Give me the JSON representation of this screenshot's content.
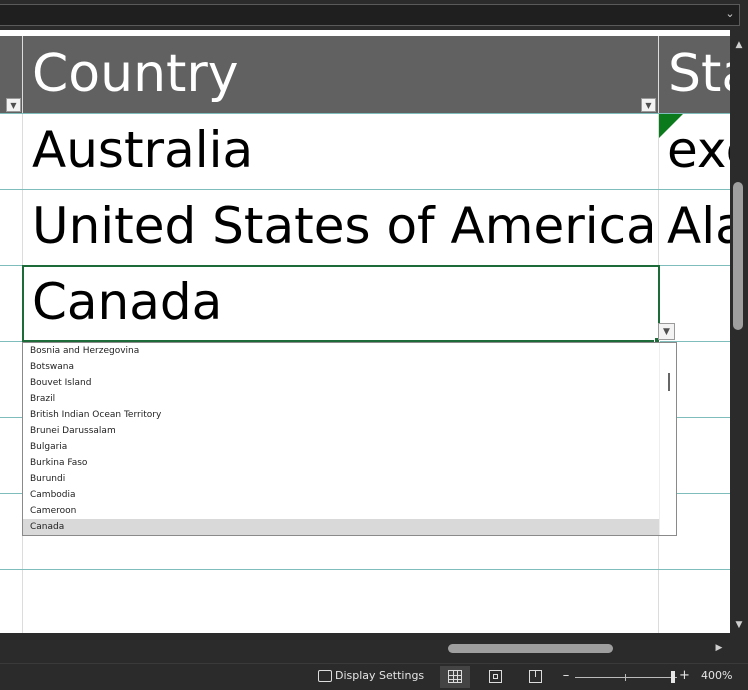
{
  "colors": {
    "header_bg": "#616161",
    "active_border": "#1e6b3a",
    "row_divider": "#7fbcbc",
    "selected_item_bg": "#d9d9d9",
    "error_flag": "#0a7a1c"
  },
  "formula_bar": {
    "expand_icon": "chevron-down-icon"
  },
  "table": {
    "headers": [
      "",
      "Country",
      "Sta"
    ],
    "filter_icon": "filter-dropdown-icon",
    "rows": [
      {
        "country": "Australia",
        "state": "exc"
      },
      {
        "country": "United States of America",
        "state": "Ala"
      },
      {
        "country": "Canada",
        "state": ""
      }
    ]
  },
  "dropdown": {
    "items": [
      "Bosnia and Herzegovina",
      "Botswana",
      "Bouvet Island",
      "Brazil",
      "British Indian Ocean Territory",
      "Brunei Darussalam",
      "Bulgaria",
      "Burkina Faso",
      "Burundi",
      "Cambodia",
      "Cameroon",
      "Canada"
    ],
    "selected": "Canada",
    "button_icon": "dropdown-arrow-icon"
  },
  "status_bar": {
    "display_settings_label": "Display Settings",
    "zoom_minus": "–",
    "zoom_plus": "+",
    "zoom_level": "400%"
  }
}
